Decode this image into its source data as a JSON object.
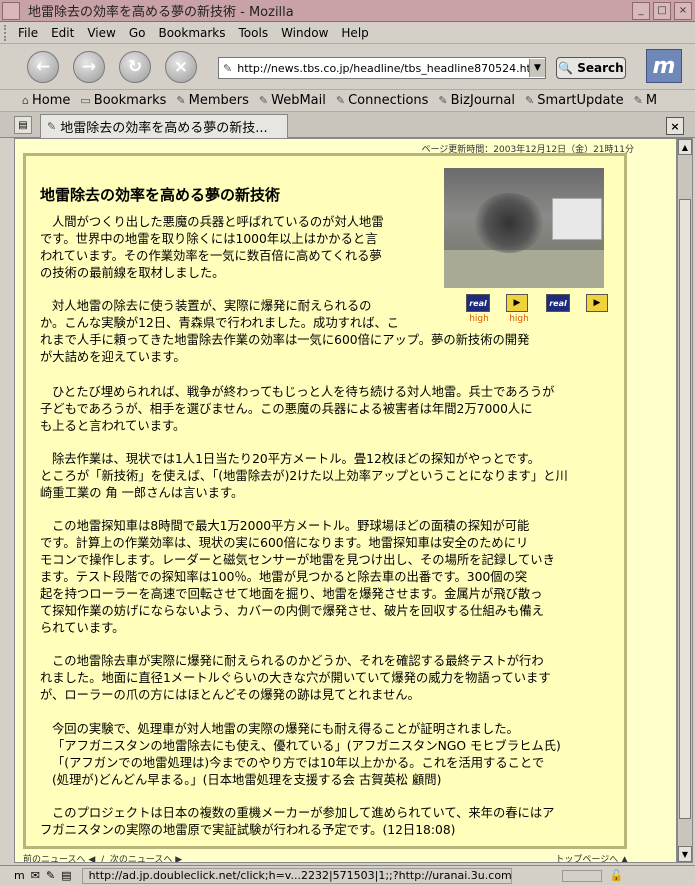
{
  "window": {
    "title": "地雷除去の効率を高める夢の新技術 - Mozilla"
  },
  "menu": [
    "File",
    "Edit",
    "View",
    "Go",
    "Bookmarks",
    "Tools",
    "Window",
    "Help"
  ],
  "nav": {
    "url": "http://news.tbs.co.jp/headline/tbs_headline870524.html",
    "search_label": "Search"
  },
  "bookmarks": [
    "Home",
    "Bookmarks",
    "Members",
    "WebMail",
    "Connections",
    "BizJournal",
    "SmartUpdate",
    "M"
  ],
  "tab": {
    "title": "地雷除去の効率を高める夢の新技..."
  },
  "article": {
    "updated": "ページ更新時間：2003年12月12日（金）21時11分",
    "headline": "地雷除去の効率を高める夢の新技術",
    "media": [
      {
        "icon": "real",
        "label": "high"
      },
      {
        "icon": "wm",
        "label": "high"
      },
      {
        "icon": "real",
        "label": ""
      },
      {
        "icon": "wm",
        "label": ""
      }
    ],
    "p1": [
      "人間がつくり出した悪魔の兵器と呼ばれているのが対人地雷",
      "です。世界中の地雷を取り除くには1000年以上はかかると言",
      "われています。その作業効率を一気に数百倍に高めてくれる夢",
      "の技術の最前線を取材しました。"
    ],
    "p2": [
      "対人地雷の除去に使う装置が、実際に爆発に耐えられるの",
      "か。こんな実験が12日、青森県で行われました。成功すれば、こ",
      "れまで人手に頼ってきた地雷除去作業の効率は一気に600倍にアップ。夢の新技術の開発",
      "が大詰めを迎えています。"
    ],
    "p3": [
      "ひとたび埋められれば、戦争が終わってもじっと人を待ち続ける対人地雷。兵士であろうが",
      "子どもであろうが、相手を選びません。この悪魔の兵器による被害者は年間2万7000人に",
      "も上ると言われています。"
    ],
    "p4": [
      "除去作業は、現状では1人1日当たり20平方メートル。畳12枚ほどの探知がやっとです。",
      "ところが「新技術」を使えば、「(地雷除去が)2けた以上効率アップということになります」と川",
      "崎重工業の 角 一郎さんは言います。"
    ],
    "p5": [
      "この地雷探知車は8時間で最大1万2000平方メートル。野球場ほどの面積の探知が可能",
      "です。計算上の作業効率は、現状の実に600倍になります。地雷探知車は安全のためにリ",
      "モコンで操作します。レーダーと磁気センサーが地雷を見つけ出し、その場所を記録していき",
      "ます。テスト段階での探知率は100％。地雷が見つかると除去車の出番です。300個の突",
      "起を持つローラーを高速で回転させて地面を掘り、地雷を爆発させます。金属片が飛び散っ",
      "て探知作業の妨げにならないよう、カバーの内側で爆発させ、破片を回収する仕組みも備え",
      "られています。"
    ],
    "p6": [
      "この地雷除去車が実際に爆発に耐えられるのかどうか、それを確認する最終テストが行わ",
      "れました。地面に直径1メートルぐらいの大きな穴が開いていて爆発の威力を物語っています",
      "が、ローラーの爪の方にはほとんどその爆発の跡は見てとれません。"
    ],
    "p7": [
      "今回の実験で、処理車が対人地雷の実際の爆発にも耐え得ることが証明されました。",
      "「アフガニスタンの地雷除去にも使え、優れている」(アフガニスタンNGO モヒブラヒム氏)",
      "「(アフガンでの地雷処理は)今までのやり方では10年以上かかる。これを活用することで",
      "(処理が)どんどん早まる。」(日本地雷処理を支援する会 古賀英松 顧問)"
    ],
    "p8": [
      "このプロジェクトは日本の複数の重機メーカーが参加して進められていて、来年の春にはア",
      "フガニスタンの実際の地雷原で実証試験が行われる予定です。(12日18:08)"
    ],
    "prev_news": "前のニュースへ",
    "next_news": "次のニュースへ",
    "top_page": "トップページへ"
  },
  "status": {
    "text": "http://ad.jp.doubleclick.net/click;h=v...2232|571503|1;;?http://uranai.3u.com/"
  }
}
